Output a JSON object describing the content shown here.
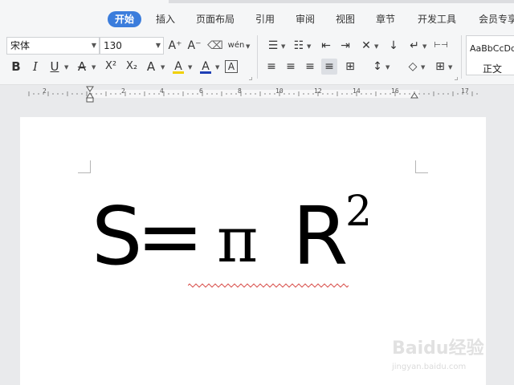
{
  "tabs": [
    {
      "label": "开始",
      "active": true
    },
    {
      "label": "插入"
    },
    {
      "label": "页面布局"
    },
    {
      "label": "引用"
    },
    {
      "label": "审阅"
    },
    {
      "label": "视图"
    },
    {
      "label": "章节"
    },
    {
      "label": "开发工具"
    },
    {
      "label": "会员专享"
    }
  ],
  "font": {
    "name": "宋体",
    "size": "130"
  },
  "toolbar": {
    "grow_font": "A⁺",
    "shrink_font": "A⁻",
    "clear_format": "⌫",
    "phonetic": "wén",
    "bold": "B",
    "italic": "I",
    "underline": "U",
    "strikethrough": "A",
    "superscript": "X²",
    "subscript": "X₂",
    "text_effect": "A",
    "highlight": "A",
    "font_color": "A",
    "char_border": "A",
    "bullets": "☰",
    "numbering": "☷",
    "outdent": "⇤",
    "indent": "⇥",
    "asian_layout": "✕",
    "sort": "↓",
    "show_marks": "↵",
    "tab_stops": "⊢⊣",
    "align_left": "≡",
    "align_center": "≡",
    "align_right": "≡",
    "justify": "≡",
    "distribute": "⊞",
    "line_spacing": "↕",
    "shading": "◇",
    "borders": "⊞"
  },
  "styles": {
    "preview": "AaBbCcDd",
    "name": "正文"
  },
  "ruler": {
    "numbers": [
      "2",
      "2",
      "4",
      "6",
      "8",
      "10",
      "12",
      "14",
      "16",
      "17"
    ]
  },
  "document": {
    "formula": {
      "lhs": "S",
      "equals": "=",
      "pi": "π",
      "r": "R",
      "exponent": "2"
    }
  },
  "watermark": {
    "line1": "Baidu经验",
    "line2": "jingyan.baidu.com"
  },
  "colors": {
    "accent": "#3b7ddc",
    "spell_error": "#d9534f",
    "font_color_bar": "#1e3fb5",
    "highlight_bar": "#f0d000"
  }
}
